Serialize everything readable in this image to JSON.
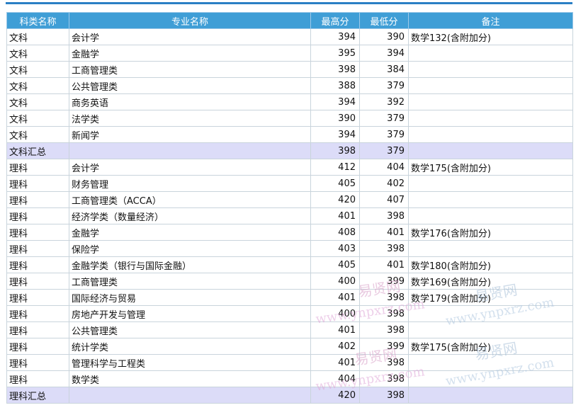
{
  "table": {
    "headers": [
      "科类名称",
      "专业名称",
      "最高分",
      "最低分",
      "备注"
    ],
    "rows": [
      {
        "category": "文科",
        "major": "会计学",
        "max": "394",
        "min": "390",
        "note": "数学132(含附加分)",
        "summary": false
      },
      {
        "category": "文科",
        "major": "金融学",
        "max": "395",
        "min": "394",
        "note": "",
        "summary": false
      },
      {
        "category": "文科",
        "major": "工商管理类",
        "max": "398",
        "min": "384",
        "note": "",
        "summary": false
      },
      {
        "category": "文科",
        "major": "公共管理类",
        "max": "388",
        "min": "379",
        "note": "",
        "summary": false
      },
      {
        "category": "文科",
        "major": "商务英语",
        "max": "394",
        "min": "392",
        "note": "",
        "summary": false
      },
      {
        "category": "文科",
        "major": "法学类",
        "max": "390",
        "min": "379",
        "note": "",
        "summary": false
      },
      {
        "category": "文科",
        "major": "新闻学",
        "max": "394",
        "min": "379",
        "note": "",
        "summary": false
      },
      {
        "category": "文科汇总",
        "major": "",
        "max": "398",
        "min": "379",
        "note": "",
        "summary": true
      },
      {
        "category": "理科",
        "major": "会计学",
        "max": "412",
        "min": "404",
        "note": "数学175(含附加分)",
        "summary": false
      },
      {
        "category": "理科",
        "major": "财务管理",
        "max": "405",
        "min": "402",
        "note": "",
        "summary": false
      },
      {
        "category": "理科",
        "major": "工商管理类（ACCA）",
        "max": "420",
        "min": "407",
        "note": "",
        "summary": false
      },
      {
        "category": "理科",
        "major": "经济学类（数量经济）",
        "max": "401",
        "min": "398",
        "note": "",
        "summary": false
      },
      {
        "category": "理科",
        "major": "金融学",
        "max": "408",
        "min": "401",
        "note": "数学176(含附加分)",
        "summary": false
      },
      {
        "category": "理科",
        "major": "保险学",
        "max": "403",
        "min": "398",
        "note": "",
        "summary": false
      },
      {
        "category": "理科",
        "major": "金融学类（银行与国际金融）",
        "max": "405",
        "min": "401",
        "note": "数学180(含附加分)",
        "summary": false
      },
      {
        "category": "理科",
        "major": "工商管理类",
        "max": "400",
        "min": "399",
        "note": "数学169(含附加分)",
        "summary": false
      },
      {
        "category": "理科",
        "major": "国际经济与贸易",
        "max": "401",
        "min": "398",
        "note": "数学179(含附加分)",
        "summary": false
      },
      {
        "category": "理科",
        "major": "房地产开发与管理",
        "max": "400",
        "min": "398",
        "note": "",
        "summary": false
      },
      {
        "category": "理科",
        "major": "公共管理类",
        "max": "401",
        "min": "398",
        "note": "",
        "summary": false
      },
      {
        "category": "理科",
        "major": "统计学类",
        "max": "402",
        "min": "399",
        "note": "数学175(含附加分)",
        "summary": false
      },
      {
        "category": "理科",
        "major": "管理科学与工程类",
        "max": "401",
        "min": "398",
        "note": "",
        "summary": false
      },
      {
        "category": "理科",
        "major": "数学类",
        "max": "404",
        "min": "398",
        "note": "",
        "summary": false
      },
      {
        "category": "理科汇总",
        "major": "",
        "max": "420",
        "min": "398",
        "note": "",
        "summary": true
      }
    ]
  },
  "watermark": {
    "cn": "易贤网",
    "url": "www.ynpxrz.com"
  }
}
